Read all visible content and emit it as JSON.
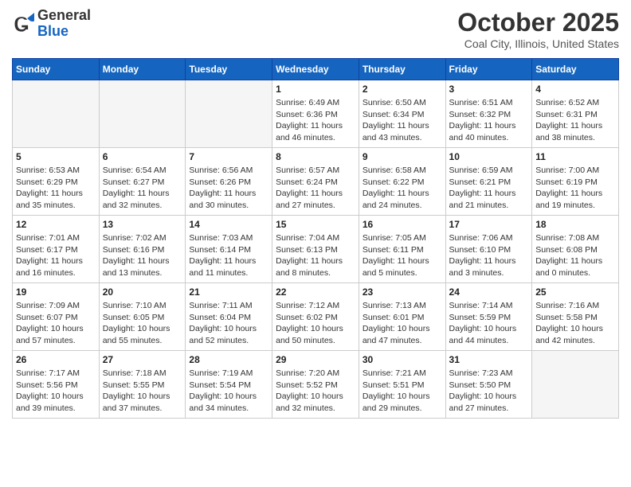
{
  "header": {
    "logo": {
      "general": "General",
      "blue": "Blue"
    },
    "title": "October 2025",
    "location": "Coal City, Illinois, United States"
  },
  "calendar": {
    "days_of_week": [
      "Sunday",
      "Monday",
      "Tuesday",
      "Wednesday",
      "Thursday",
      "Friday",
      "Saturday"
    ],
    "weeks": [
      [
        {
          "day": "",
          "empty": true
        },
        {
          "day": "",
          "empty": true
        },
        {
          "day": "",
          "empty": true
        },
        {
          "day": "1",
          "sunrise": "6:49 AM",
          "sunset": "6:36 PM",
          "daylight": "11 hours and 46 minutes."
        },
        {
          "day": "2",
          "sunrise": "6:50 AM",
          "sunset": "6:34 PM",
          "daylight": "11 hours and 43 minutes."
        },
        {
          "day": "3",
          "sunrise": "6:51 AM",
          "sunset": "6:32 PM",
          "daylight": "11 hours and 40 minutes."
        },
        {
          "day": "4",
          "sunrise": "6:52 AM",
          "sunset": "6:31 PM",
          "daylight": "11 hours and 38 minutes."
        }
      ],
      [
        {
          "day": "5",
          "sunrise": "6:53 AM",
          "sunset": "6:29 PM",
          "daylight": "11 hours and 35 minutes."
        },
        {
          "day": "6",
          "sunrise": "6:54 AM",
          "sunset": "6:27 PM",
          "daylight": "11 hours and 32 minutes."
        },
        {
          "day": "7",
          "sunrise": "6:56 AM",
          "sunset": "6:26 PM",
          "daylight": "11 hours and 30 minutes."
        },
        {
          "day": "8",
          "sunrise": "6:57 AM",
          "sunset": "6:24 PM",
          "daylight": "11 hours and 27 minutes."
        },
        {
          "day": "9",
          "sunrise": "6:58 AM",
          "sunset": "6:22 PM",
          "daylight": "11 hours and 24 minutes."
        },
        {
          "day": "10",
          "sunrise": "6:59 AM",
          "sunset": "6:21 PM",
          "daylight": "11 hours and 21 minutes."
        },
        {
          "day": "11",
          "sunrise": "7:00 AM",
          "sunset": "6:19 PM",
          "daylight": "11 hours and 19 minutes."
        }
      ],
      [
        {
          "day": "12",
          "sunrise": "7:01 AM",
          "sunset": "6:17 PM",
          "daylight": "11 hours and 16 minutes."
        },
        {
          "day": "13",
          "sunrise": "7:02 AM",
          "sunset": "6:16 PM",
          "daylight": "11 hours and 13 minutes."
        },
        {
          "day": "14",
          "sunrise": "7:03 AM",
          "sunset": "6:14 PM",
          "daylight": "11 hours and 11 minutes."
        },
        {
          "day": "15",
          "sunrise": "7:04 AM",
          "sunset": "6:13 PM",
          "daylight": "11 hours and 8 minutes."
        },
        {
          "day": "16",
          "sunrise": "7:05 AM",
          "sunset": "6:11 PM",
          "daylight": "11 hours and 5 minutes."
        },
        {
          "day": "17",
          "sunrise": "7:06 AM",
          "sunset": "6:10 PM",
          "daylight": "11 hours and 3 minutes."
        },
        {
          "day": "18",
          "sunrise": "7:08 AM",
          "sunset": "6:08 PM",
          "daylight": "11 hours and 0 minutes."
        }
      ],
      [
        {
          "day": "19",
          "sunrise": "7:09 AM",
          "sunset": "6:07 PM",
          "daylight": "10 hours and 57 minutes."
        },
        {
          "day": "20",
          "sunrise": "7:10 AM",
          "sunset": "6:05 PM",
          "daylight": "10 hours and 55 minutes."
        },
        {
          "day": "21",
          "sunrise": "7:11 AM",
          "sunset": "6:04 PM",
          "daylight": "10 hours and 52 minutes."
        },
        {
          "day": "22",
          "sunrise": "7:12 AM",
          "sunset": "6:02 PM",
          "daylight": "10 hours and 50 minutes."
        },
        {
          "day": "23",
          "sunrise": "7:13 AM",
          "sunset": "6:01 PM",
          "daylight": "10 hours and 47 minutes."
        },
        {
          "day": "24",
          "sunrise": "7:14 AM",
          "sunset": "5:59 PM",
          "daylight": "10 hours and 44 minutes."
        },
        {
          "day": "25",
          "sunrise": "7:16 AM",
          "sunset": "5:58 PM",
          "daylight": "10 hours and 42 minutes."
        }
      ],
      [
        {
          "day": "26",
          "sunrise": "7:17 AM",
          "sunset": "5:56 PM",
          "daylight": "10 hours and 39 minutes."
        },
        {
          "day": "27",
          "sunrise": "7:18 AM",
          "sunset": "5:55 PM",
          "daylight": "10 hours and 37 minutes."
        },
        {
          "day": "28",
          "sunrise": "7:19 AM",
          "sunset": "5:54 PM",
          "daylight": "10 hours and 34 minutes."
        },
        {
          "day": "29",
          "sunrise": "7:20 AM",
          "sunset": "5:52 PM",
          "daylight": "10 hours and 32 minutes."
        },
        {
          "day": "30",
          "sunrise": "7:21 AM",
          "sunset": "5:51 PM",
          "daylight": "10 hours and 29 minutes."
        },
        {
          "day": "31",
          "sunrise": "7:23 AM",
          "sunset": "5:50 PM",
          "daylight": "10 hours and 27 minutes."
        },
        {
          "day": "",
          "empty": true
        }
      ]
    ]
  },
  "labels": {
    "sunrise_prefix": "Sunrise: ",
    "sunset_prefix": "Sunset: ",
    "daylight_prefix": "Daylight: "
  }
}
